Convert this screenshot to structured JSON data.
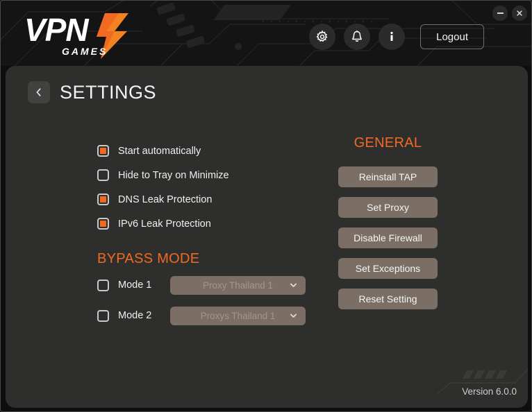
{
  "window": {
    "minimize_label": "minimize",
    "close_label": "×"
  },
  "header": {
    "logo": {
      "primary_text": "VPN",
      "sub_text": "GAMES",
      "bolt_icon": "lightning-bolt-icon"
    },
    "icon_buttons": [
      {
        "name": "settings-gear-button",
        "icon": "gear-icon"
      },
      {
        "name": "notifications-button",
        "icon": "bell-icon"
      },
      {
        "name": "info-button",
        "icon": "info-icon"
      }
    ],
    "logout_label": "Logout"
  },
  "page": {
    "back_icon": "chevron-left-icon",
    "title": "SETTINGS"
  },
  "options": [
    {
      "label": "Start automatically",
      "checked": true
    },
    {
      "label": "Hide to Tray on Minimize",
      "checked": false
    },
    {
      "label": "DNS Leak Protection",
      "checked": true
    },
    {
      "label": "IPv6 Leak Protection",
      "checked": true
    }
  ],
  "bypass": {
    "title": "BYPASS MODE",
    "modes": [
      {
        "label": "Mode 1",
        "checked": false,
        "selected_option": "Proxy Thailand 1",
        "arrow_icon": "chevron-down-icon"
      },
      {
        "label": "Mode 2",
        "checked": false,
        "selected_option": "Proxys Thailand 1",
        "arrow_icon": "chevron-down-icon"
      }
    ]
  },
  "general": {
    "title": "GENERAL",
    "buttons": [
      {
        "label": "Reinstall TAP"
      },
      {
        "label": "Set Proxy"
      },
      {
        "label": "Disable Firewall"
      },
      {
        "label": "Set Exceptions"
      },
      {
        "label": "Reset Setting"
      }
    ]
  },
  "footer": {
    "version": "Version 6.0.0"
  },
  "colors": {
    "accent_orange": "#f26a21",
    "panel_bg": "#2e2e2c",
    "app_bg": "#0e0e0e",
    "header_bg": "#141414",
    "button_taupe": "#7b6f65",
    "text_primary": "#f0f0f0"
  }
}
